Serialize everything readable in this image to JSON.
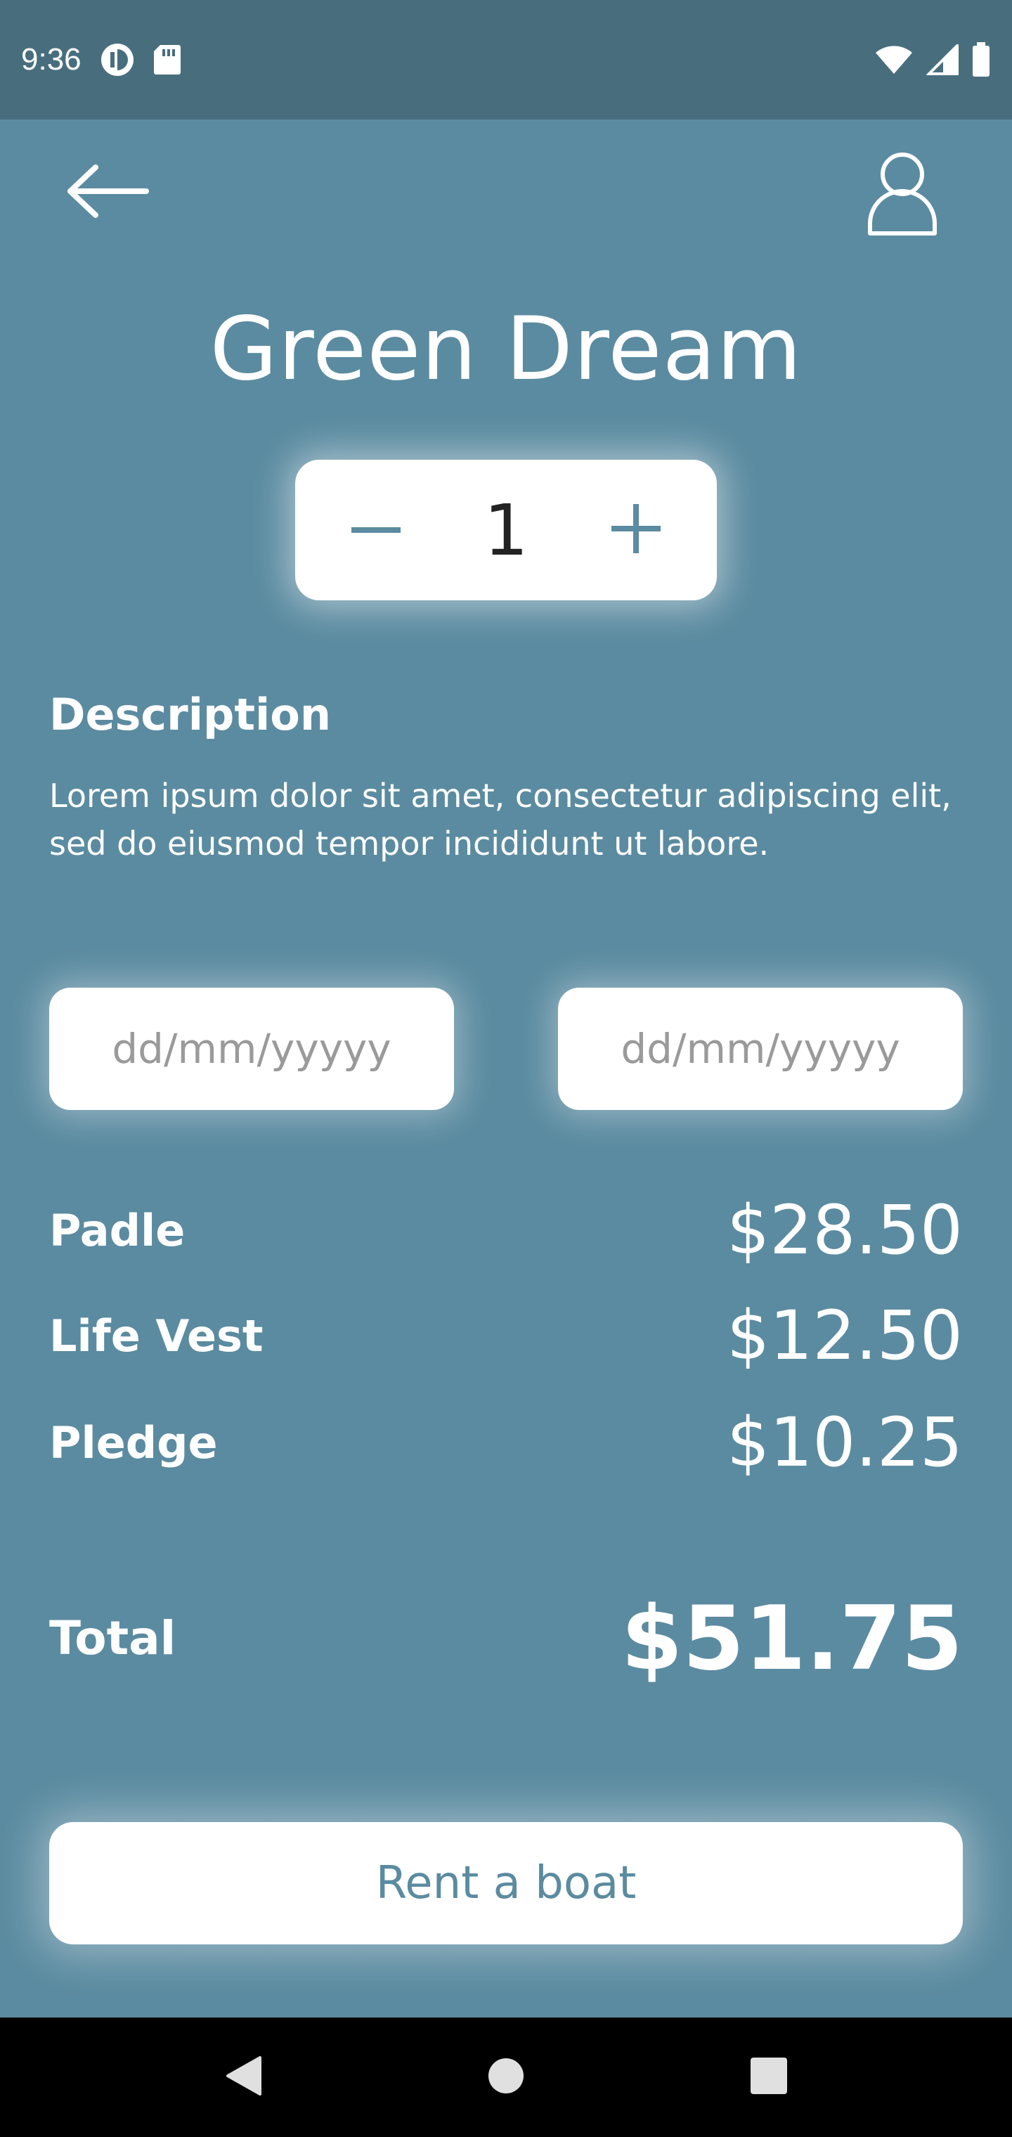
{
  "status_bar": {
    "time": "9:36",
    "icons": [
      "privacy-dot-icon",
      "sd-card-icon",
      "wifi-icon",
      "cell-signal-icon",
      "battery-icon"
    ]
  },
  "header": {
    "back_icon": "arrow-left-icon",
    "profile_icon": "user-icon"
  },
  "product": {
    "title": "Green Dream",
    "quantity": "1",
    "minus_icon": "minus-icon",
    "plus_icon": "plus-icon"
  },
  "description": {
    "heading": "Description",
    "text": "Lorem ipsum dolor sit amet, consectetur adipiscing elit, sed do eiusmod tempor incididunt ut labore."
  },
  "dates": {
    "start_placeholder": "dd/mm/yyyyy",
    "end_placeholder": "dd/mm/yyyyy"
  },
  "prices": [
    {
      "label": "Padle",
      "value": "$28.50"
    },
    {
      "label": "Life Vest",
      "value": "$12.50"
    },
    {
      "label": "Pledge",
      "value": "$10.25"
    }
  ],
  "total": {
    "label": "Total",
    "value": "$51.75"
  },
  "rent_button": {
    "label": "Rent a boat"
  },
  "nav_bar": {
    "icons": [
      "back-triangle-icon",
      "home-circle-icon",
      "recents-square-icon"
    ]
  },
  "colors": {
    "background": "#5b8ba0",
    "status_bar": "#486e7e",
    "accent": "#5b8ba0",
    "card": "#ffffff"
  }
}
